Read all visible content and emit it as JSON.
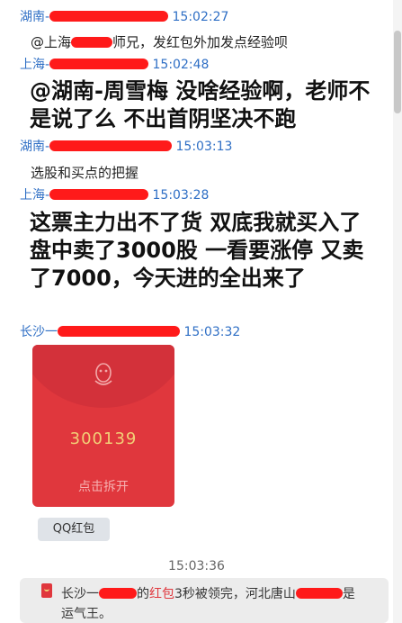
{
  "messages": [
    {
      "sender": "湖南-",
      "time": "15:02:27",
      "text_before": "@上海",
      "text_after": "师兄，发红包外加发点经验呗"
    },
    {
      "sender": "上海-",
      "time": "15:02:48",
      "big_text": "@湖南-周雪梅 没啥经验啊，老师不是说了么 不出首阴坚决不跑"
    },
    {
      "sender": "湖南-",
      "time": "15:03:13",
      "text": "选股和买点的把握"
    },
    {
      "sender": "上海-",
      "time": "15:03:28",
      "big_text": "这票主力出不了货 双底我就买入了 盘中卖了3000股 一看要涨停 又卖了7000，今天进的全出来了"
    },
    {
      "sender": "长沙一",
      "time": "15:03:32"
    }
  ],
  "red_packet": {
    "code": "300139",
    "open_label": "点击拆开",
    "tag": "QQ红包",
    "packet_color": "#e0373d",
    "code_color": "#f2cf77"
  },
  "system": {
    "time": "15:03:36",
    "notice_prefix": "长沙一",
    "notice_mid": "的",
    "notice_red": "红包",
    "notice_after": "3秒被领完，河北唐山",
    "notice_end": "是",
    "notice_line2": "运气王。"
  },
  "colors": {
    "sender": "#2f6fc5",
    "redaction": "#ff1a1a"
  }
}
